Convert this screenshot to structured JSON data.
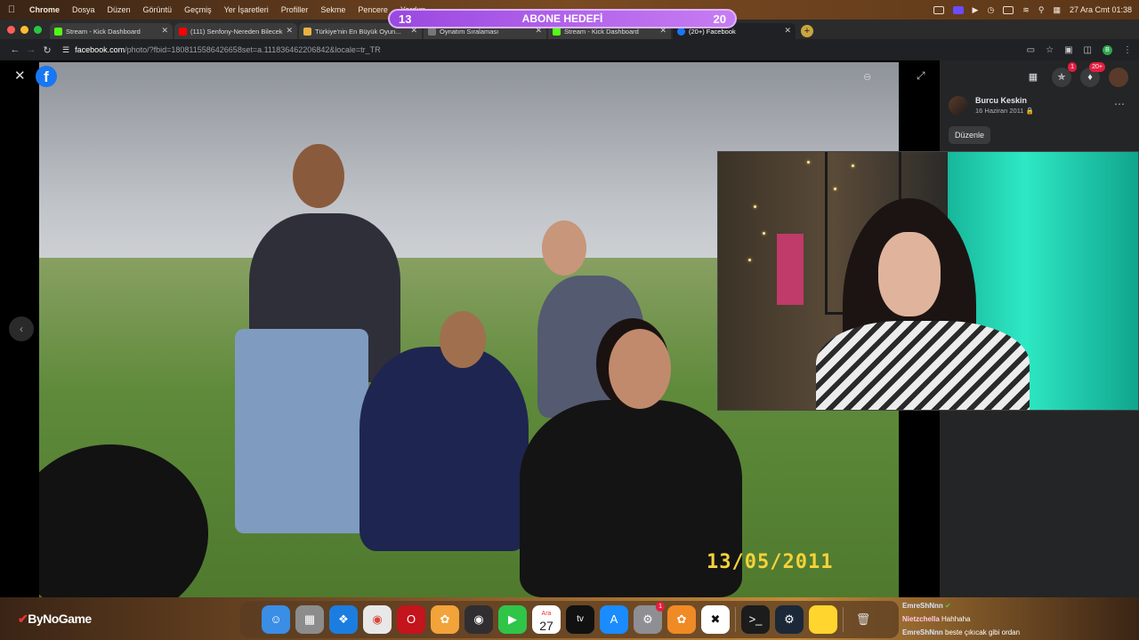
{
  "menubar": {
    "items": [
      "Chrome",
      "Dosya",
      "Düzen",
      "Görüntü",
      "Geçmiş",
      "Yer İşaretleri",
      "Profiller",
      "Sekme",
      "Pencere",
      "Yardım"
    ],
    "clock": "27 Ara Cmt 01:38"
  },
  "abone": {
    "current": "13",
    "label": "ABONE HEDEFİ",
    "target": "20"
  },
  "tabs": [
    {
      "title": "Stream - Kick Dashboard",
      "color": "#53fc18"
    },
    {
      "title": "(111) Senfony-Nereden Bilecek",
      "color": "#ff0000"
    },
    {
      "title": "Türkiye'nin En Büyük Oyun...",
      "color": "#e8b341"
    },
    {
      "title": "Oynatım Sıralaması",
      "color": "#777777"
    },
    {
      "title": "Stream - Kick Dashboard",
      "color": "#53fc18"
    },
    {
      "title": "(20+) Facebook",
      "color": "#1877f2"
    }
  ],
  "address": {
    "host": "facebook.com",
    "path": "/photo/?fbid=1808115586426658set=a.111836462206842&locale=tr_TR"
  },
  "photo": {
    "datestamp": "13/05/2011"
  },
  "sidepanel": {
    "author": "Burcu Keskin",
    "date": "16 Haziran 2011",
    "edit_label": "Düzenle",
    "messenger_badge": "1",
    "notif_badge": "20+"
  },
  "dock": {
    "apps": [
      {
        "name": "finder-icon",
        "color": "#3a8ee6"
      },
      {
        "name": "launchpad-icon",
        "color": "#8c8c8c"
      },
      {
        "name": "safari-icon",
        "color": "#1c7de0"
      },
      {
        "name": "chrome-icon",
        "color": "#e8e8e8"
      },
      {
        "name": "opera-icon",
        "color": "#c4141c"
      },
      {
        "name": "photos-icon",
        "color": "#f2a33a"
      },
      {
        "name": "obs-icon",
        "color": "#302e31"
      },
      {
        "name": "facetime-icon",
        "color": "#2fc548"
      },
      {
        "name": "calendar-icon",
        "color": "#ffffff"
      },
      {
        "name": "appletv-icon",
        "color": "#111111"
      },
      {
        "name": "appstore-icon",
        "color": "#1a8cff"
      },
      {
        "name": "settings-icon",
        "color": "#8e8e93"
      },
      {
        "name": "fl-studio-icon",
        "color": "#f08a24"
      },
      {
        "name": "capcut-icon",
        "color": "#ffffff"
      },
      {
        "name": "terminal-icon",
        "color": "#1c1c1c"
      },
      {
        "name": "steam-icon",
        "color": "#1b2838"
      },
      {
        "name": "notes-icon",
        "color": "#ffd52e"
      },
      {
        "name": "trash-icon",
        "color": "#c8c8c8"
      }
    ],
    "calendar_month": "Ara",
    "calendar_day": "27",
    "tv_label": "tv",
    "settings_badge": "1"
  },
  "brand": "ByNoGame",
  "chat": [
    {
      "user": "EmreShNnn",
      "msg": ""
    },
    {
      "user": "Nietzchella",
      "msg": "Hahhaha"
    },
    {
      "user": "EmreShNnn",
      "msg": "beste çıkıcak gibi ordan"
    }
  ]
}
